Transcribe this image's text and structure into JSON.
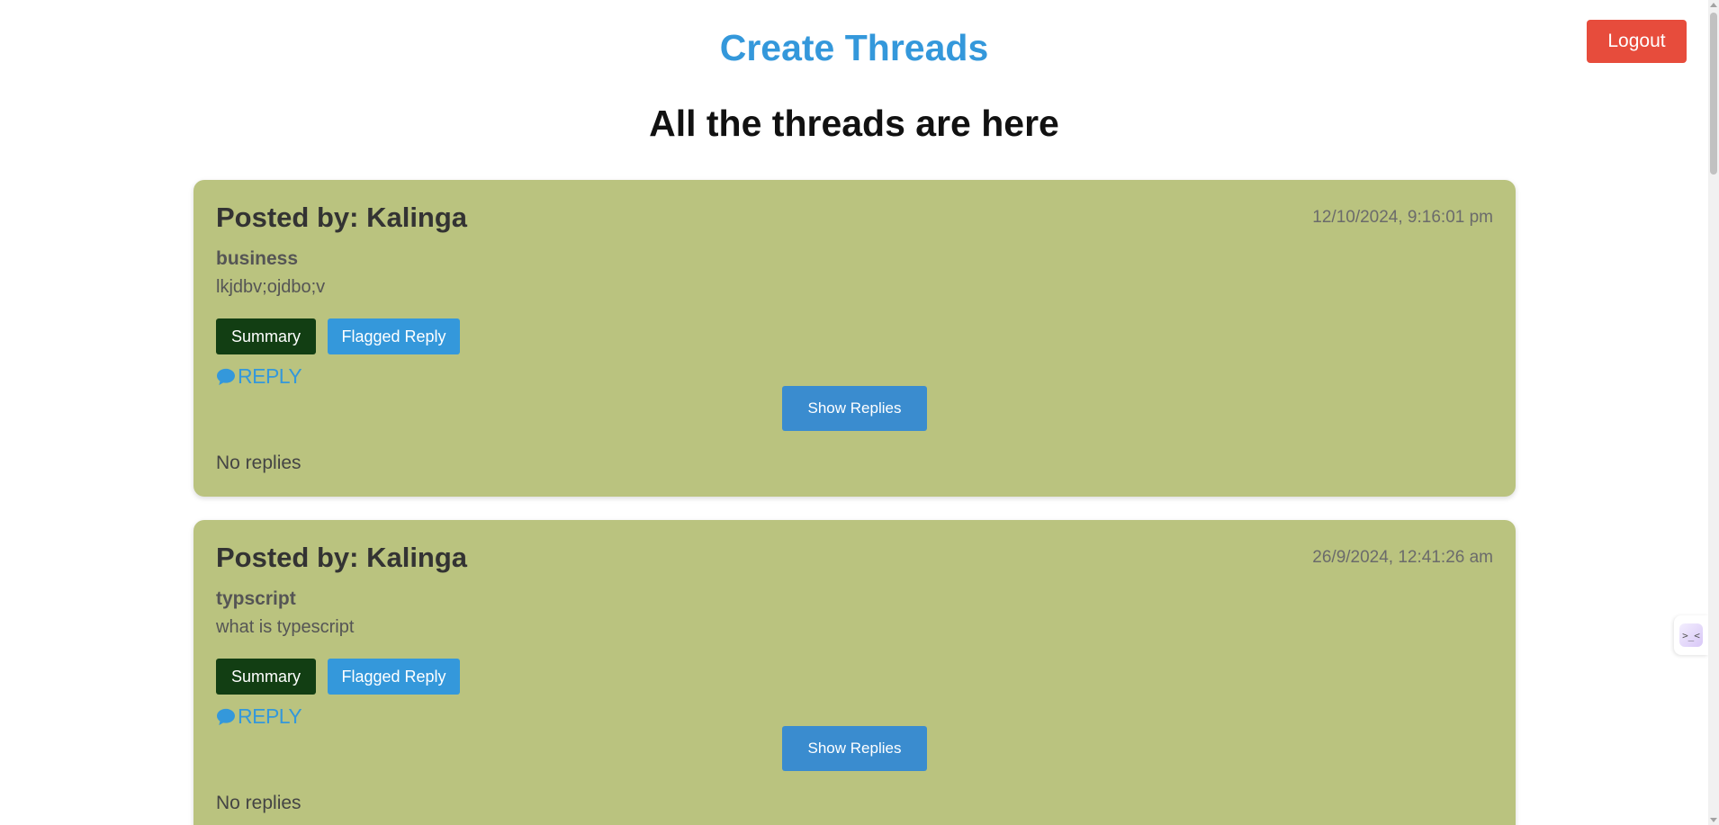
{
  "header": {
    "title": "Create Threads",
    "logout_label": "Logout",
    "section_title": "All the threads are here"
  },
  "threads": [
    {
      "posted_by": "Posted by: Kalinga",
      "timestamp": "12/10/2024, 9:16:01 pm",
      "topic": "business",
      "body": "lkjdbv;ojdbo;v",
      "summary_label": "Summary",
      "flagged_label": "Flagged Reply",
      "reply_label": "REPLY",
      "show_replies_label": "Show Replies",
      "replies_status": "No replies"
    },
    {
      "posted_by": "Posted by: Kalinga",
      "timestamp": "26/9/2024, 12:41:26 am",
      "topic": "typscript",
      "body": "what is typescript",
      "summary_label": "Summary",
      "flagged_label": "Flagged Reply",
      "reply_label": "REPLY",
      "show_replies_label": "Show Replies",
      "replies_status": "No replies"
    }
  ],
  "icons": {
    "reply": "comment-icon",
    "side_widget": "code-assistant-icon"
  },
  "side_widget": {
    "glyph": ">_<"
  },
  "colors": {
    "accent": "#3498db",
    "logout": "#e74c3c",
    "card_bg": "#bac37f",
    "summary_btn": "#123e13"
  }
}
